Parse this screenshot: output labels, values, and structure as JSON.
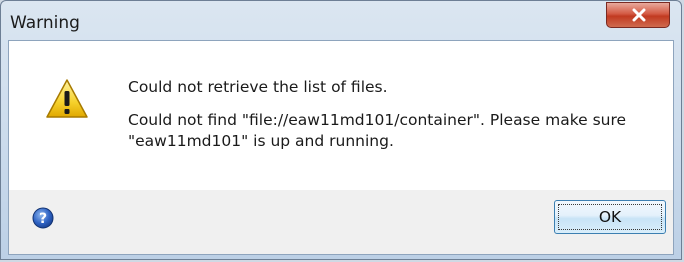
{
  "dialog": {
    "title": "Warning",
    "close_icon": "close-icon",
    "icon": "warning-icon",
    "message_primary": "Could not retrieve the list of files.",
    "message_secondary": "Could not find \"file://eaw11md101/container\". Please make sure \"eaw11md101\" is up and running.",
    "help_icon": "help-icon",
    "ok_label": "OK"
  }
}
